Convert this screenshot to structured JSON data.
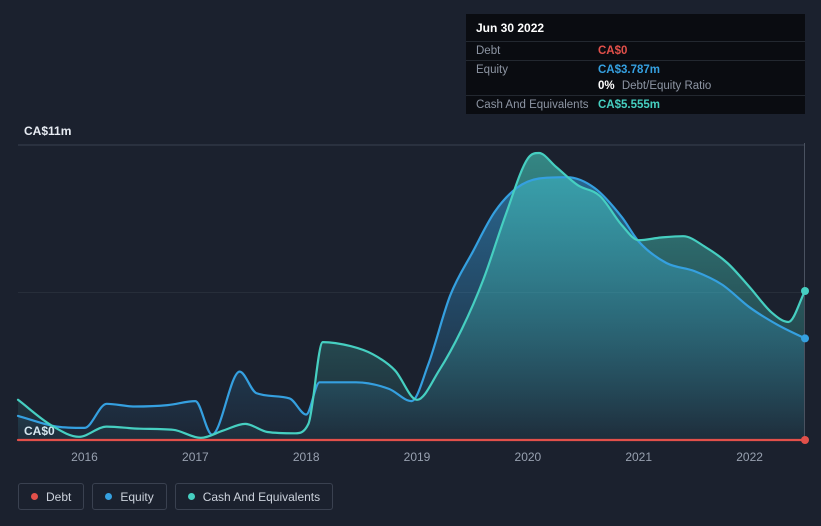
{
  "tooltip": {
    "date": "Jun 30 2022",
    "debt_label": "Debt",
    "debt_value": "CA$0",
    "equity_label": "Equity",
    "equity_value": "CA$3.787m",
    "ratio_value": "0%",
    "ratio_label": "Debt/Equity Ratio",
    "cash_label": "Cash And Equivalents",
    "cash_value": "CA$5.555m"
  },
  "chart_data": {
    "type": "area",
    "units": "CA$ millions",
    "x_domain": [
      2015.4,
      2022.5
    ],
    "x_ticks": [
      2016,
      2017,
      2018,
      2019,
      2020,
      2021,
      2022
    ],
    "ylim": [
      0,
      11
    ],
    "y_axis": {
      "top_label": "CA$11m",
      "bottom_label": "CA$0"
    },
    "grid": "horizontal",
    "legend_position": "bottom-left",
    "series": [
      {
        "name": "Debt",
        "color": "#e2504a",
        "fill": false,
        "points": [
          [
            2015.4,
            0
          ],
          [
            2022.5,
            0
          ]
        ]
      },
      {
        "name": "Equity",
        "color": "#35a0e0",
        "fill": true,
        "points": [
          [
            2015.4,
            0.9
          ],
          [
            2015.75,
            0.5
          ],
          [
            2016.0,
            0.45
          ],
          [
            2016.2,
            1.35
          ],
          [
            2016.45,
            1.25
          ],
          [
            2016.75,
            1.3
          ],
          [
            2017.0,
            1.45
          ],
          [
            2017.15,
            0.2
          ],
          [
            2017.4,
            2.55
          ],
          [
            2017.55,
            1.75
          ],
          [
            2017.85,
            1.55
          ],
          [
            2018.0,
            0.95
          ],
          [
            2018.12,
            2.15
          ],
          [
            2018.45,
            2.15
          ],
          [
            2018.75,
            1.9
          ],
          [
            2018.95,
            1.45
          ],
          [
            2019.1,
            2.8
          ],
          [
            2019.3,
            5.4
          ],
          [
            2019.5,
            7.0
          ],
          [
            2019.7,
            8.5
          ],
          [
            2019.9,
            9.4
          ],
          [
            2020.1,
            9.75
          ],
          [
            2020.35,
            9.8
          ],
          [
            2020.6,
            9.4
          ],
          [
            2020.85,
            8.3
          ],
          [
            2021.0,
            7.4
          ],
          [
            2021.25,
            6.6
          ],
          [
            2021.5,
            6.3
          ],
          [
            2021.75,
            5.8
          ],
          [
            2022.0,
            4.95
          ],
          [
            2022.25,
            4.3
          ],
          [
            2022.5,
            3.787
          ]
        ]
      },
      {
        "name": "Cash And Equivalents",
        "color": "#46cfc1",
        "fill": true,
        "points": [
          [
            2015.4,
            1.5
          ],
          [
            2015.7,
            0.55
          ],
          [
            2015.95,
            0.12
          ],
          [
            2016.2,
            0.5
          ],
          [
            2016.5,
            0.42
          ],
          [
            2016.8,
            0.38
          ],
          [
            2017.05,
            0.08
          ],
          [
            2017.25,
            0.35
          ],
          [
            2017.45,
            0.6
          ],
          [
            2017.65,
            0.3
          ],
          [
            2017.9,
            0.25
          ],
          [
            2018.02,
            0.6
          ],
          [
            2018.15,
            3.65
          ],
          [
            2018.4,
            3.5
          ],
          [
            2018.6,
            3.2
          ],
          [
            2018.8,
            2.6
          ],
          [
            2019.0,
            1.5
          ],
          [
            2019.2,
            2.6
          ],
          [
            2019.4,
            4.1
          ],
          [
            2019.6,
            6.0
          ],
          [
            2019.8,
            8.4
          ],
          [
            2020.0,
            10.5
          ],
          [
            2020.1,
            10.7
          ],
          [
            2020.25,
            10.2
          ],
          [
            2020.45,
            9.5
          ],
          [
            2020.65,
            9.1
          ],
          [
            2020.85,
            8.0
          ],
          [
            2021.0,
            7.45
          ],
          [
            2021.2,
            7.55
          ],
          [
            2021.4,
            7.6
          ],
          [
            2021.6,
            7.2
          ],
          [
            2021.8,
            6.6
          ],
          [
            2022.0,
            5.7
          ],
          [
            2022.2,
            4.75
          ],
          [
            2022.35,
            4.4
          ],
          [
            2022.5,
            5.555
          ]
        ]
      }
    ]
  }
}
